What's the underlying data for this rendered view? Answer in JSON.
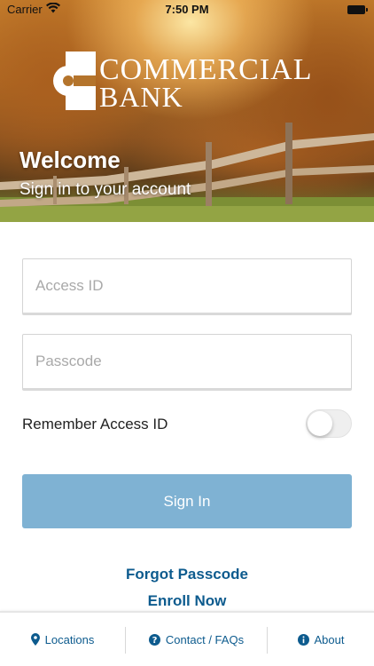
{
  "status_bar": {
    "carrier": "Carrier",
    "time": "7:50 PM"
  },
  "hero": {
    "logo_line_1": "COMMERCIAL",
    "logo_line_2": "BANK",
    "title": "Welcome",
    "subtitle": "Sign in to your account"
  },
  "form": {
    "access_id": {
      "value": "",
      "placeholder": "Access ID"
    },
    "passcode": {
      "value": "",
      "placeholder": "Passcode"
    },
    "remember_label": "Remember Access ID",
    "remember_on": false,
    "sign_in_label": "Sign In"
  },
  "links": {
    "forgot": "Forgot Passcode",
    "enroll": "Enroll Now"
  },
  "bottom_nav": {
    "locations": "Locations",
    "contact": "Contact / FAQs",
    "about": "About"
  },
  "colors": {
    "primary": "#0d5b8e",
    "sign_in_button": "#7fb2d3"
  },
  "icons": [
    "wifi-icon",
    "battery-icon",
    "bank-logo-icon",
    "location-pin-icon",
    "question-icon",
    "info-icon"
  ]
}
